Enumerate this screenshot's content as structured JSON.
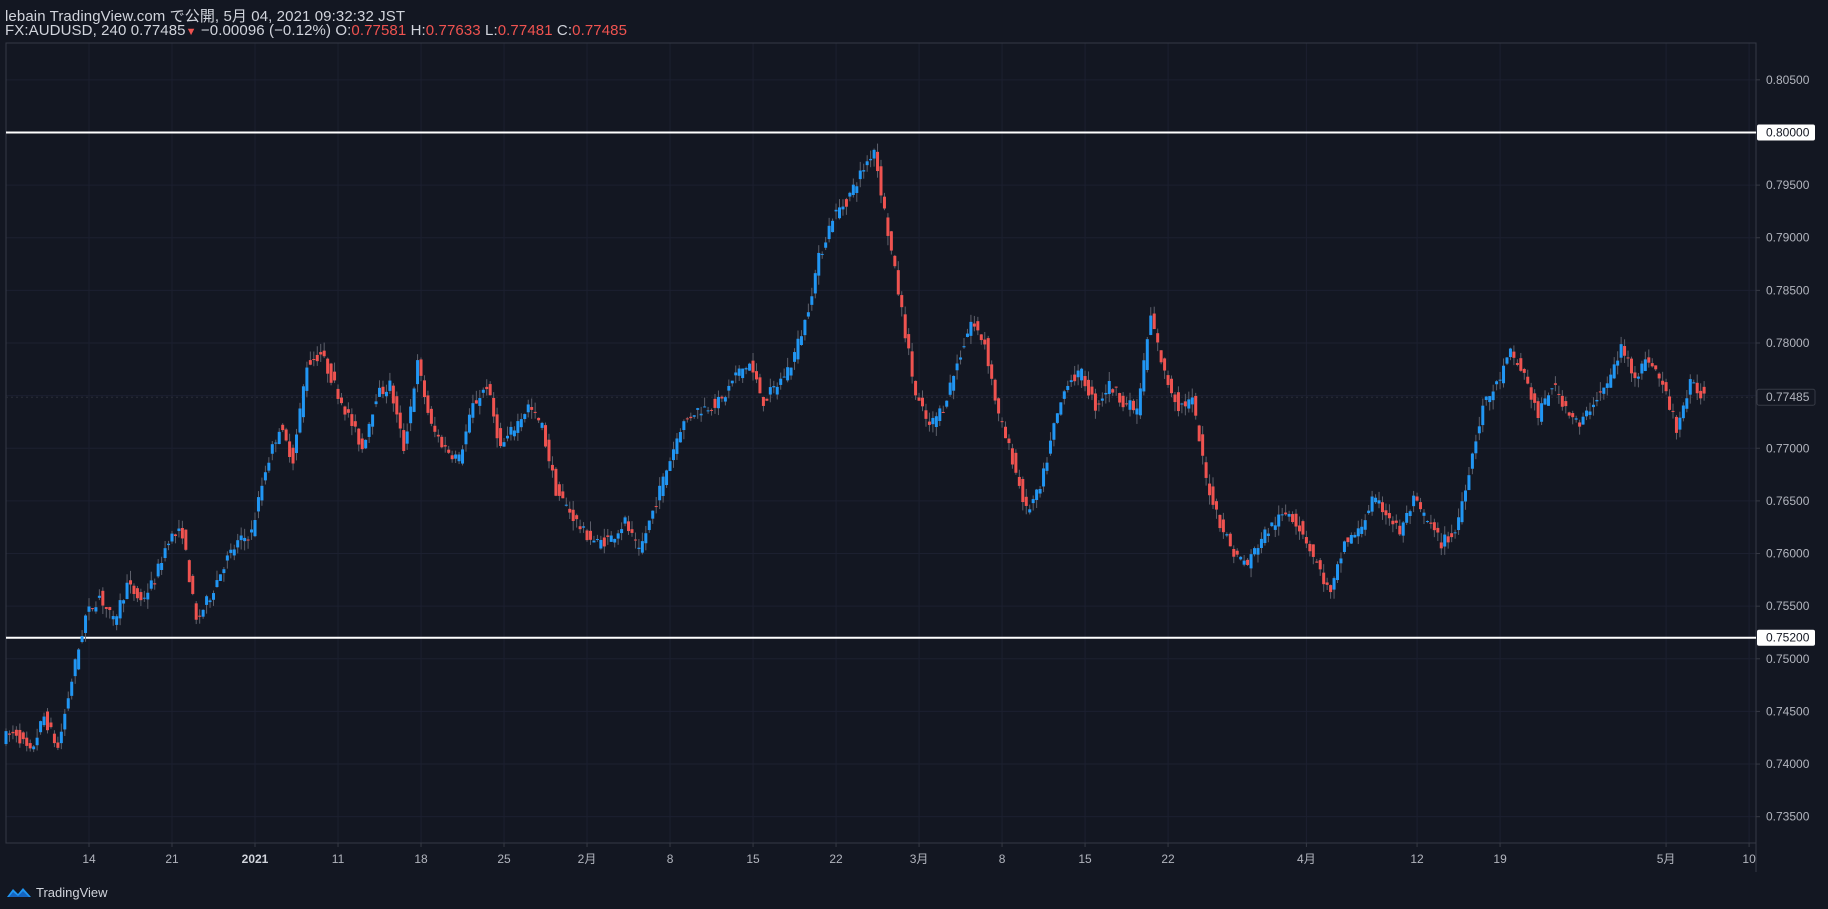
{
  "header": {
    "line1": "lebain TradingView.com で公開, 5月 04, 2021 09:32:32 JST",
    "symbol": "FX:AUDUSD, 240 0.77485",
    "change": "−0.00096 (−0.12%)",
    "o_label": "O:",
    "o_val": "0.77581",
    "h_label": "H:",
    "h_val": "0.77633",
    "l_label": "L:",
    "l_val": "0.77481",
    "c_label": "C:",
    "c_val": "0.77485"
  },
  "footer": {
    "brand": "TradingView",
    "icon": "tradingview-logo-icon"
  },
  "colors": {
    "background": "#131722",
    "up": "#2196f3",
    "down": "#ef5350",
    "level": "#ffffff"
  },
  "chart_data": {
    "type": "candlestick",
    "symbol": "FX:AUDUSD",
    "interval": "240",
    "ylim": [
      0.7325,
      0.8085
    ],
    "y_ticks": [
      "0.73500",
      "0.74000",
      "0.74500",
      "0.75000",
      "0.75500",
      "0.76000",
      "0.76500",
      "0.77000",
      "0.77500",
      "0.78000",
      "0.78500",
      "0.79000",
      "0.79500",
      "0.80000",
      "0.80500"
    ],
    "x_ticks": [
      {
        "label": "14",
        "idx": 6
      },
      {
        "label": "21",
        "idx": 12
      },
      {
        "label": "2021",
        "idx": 18,
        "bold": true
      },
      {
        "label": "11",
        "idx": 24
      },
      {
        "label": "18",
        "idx": 30
      },
      {
        "label": "25",
        "idx": 36
      },
      {
        "label": "2月",
        "idx": 42
      },
      {
        "label": "8",
        "idx": 48
      },
      {
        "label": "15",
        "idx": 54
      },
      {
        "label": "22",
        "idx": 60
      },
      {
        "label": "3月",
        "idx": 66
      },
      {
        "label": "8",
        "idx": 72
      },
      {
        "label": "15",
        "idx": 78
      },
      {
        "label": "22",
        "idx": 84
      },
      {
        "label": "4月",
        "idx": 94
      },
      {
        "label": "12",
        "idx": 102
      },
      {
        "label": "19",
        "idx": 108
      },
      {
        "label": "5月",
        "idx": 120
      },
      {
        "label": "10",
        "idx": 126
      }
    ],
    "x_range": [
      0,
      126.5
    ],
    "horizontal_levels": [
      0.8,
      0.752
    ],
    "last_price": 0.77485,
    "closes": [
      0.743,
      0.741,
      0.7445,
      0.7415,
      0.748,
      0.754,
      0.756,
      0.7535,
      0.757,
      0.7555,
      0.7575,
      0.7615,
      0.762,
      0.7535,
      0.756,
      0.759,
      0.761,
      0.762,
      0.768,
      0.772,
      0.769,
      0.778,
      0.779,
      0.776,
      0.773,
      0.77,
      0.775,
      0.776,
      0.77,
      0.778,
      0.772,
      0.77,
      0.769,
      0.774,
      0.776,
      0.77,
      0.772,
      0.774,
      0.772,
      0.766,
      0.764,
      0.762,
      0.761,
      0.7615,
      0.763,
      0.76,
      0.764,
      0.768,
      0.772,
      0.7735,
      0.774,
      0.7745,
      0.777,
      0.778,
      0.7745,
      0.776,
      0.778,
      0.782,
      0.788,
      0.792,
      0.7935,
      0.796,
      0.7985,
      0.7905,
      0.783,
      0.775,
      0.772,
      0.774,
      0.778,
      0.782,
      0.78,
      0.773,
      0.769,
      0.764,
      0.766,
      0.772,
      0.7765,
      0.777,
      0.774,
      0.776,
      0.7745,
      0.7735,
      0.7825,
      0.777,
      0.774,
      0.7745,
      0.767,
      0.763,
      0.76,
      0.759,
      0.7615,
      0.763,
      0.764,
      0.762,
      0.759,
      0.756,
      0.761,
      0.762,
      0.765,
      0.764,
      0.762,
      0.765,
      0.763,
      0.761,
      0.762,
      0.768,
      0.774,
      0.776,
      0.779,
      0.777,
      0.773,
      0.776,
      0.774,
      0.772,
      0.7745,
      0.776,
      0.7795,
      0.777,
      0.7785,
      0.776,
      0.772,
      0.776,
      0.775
    ]
  }
}
